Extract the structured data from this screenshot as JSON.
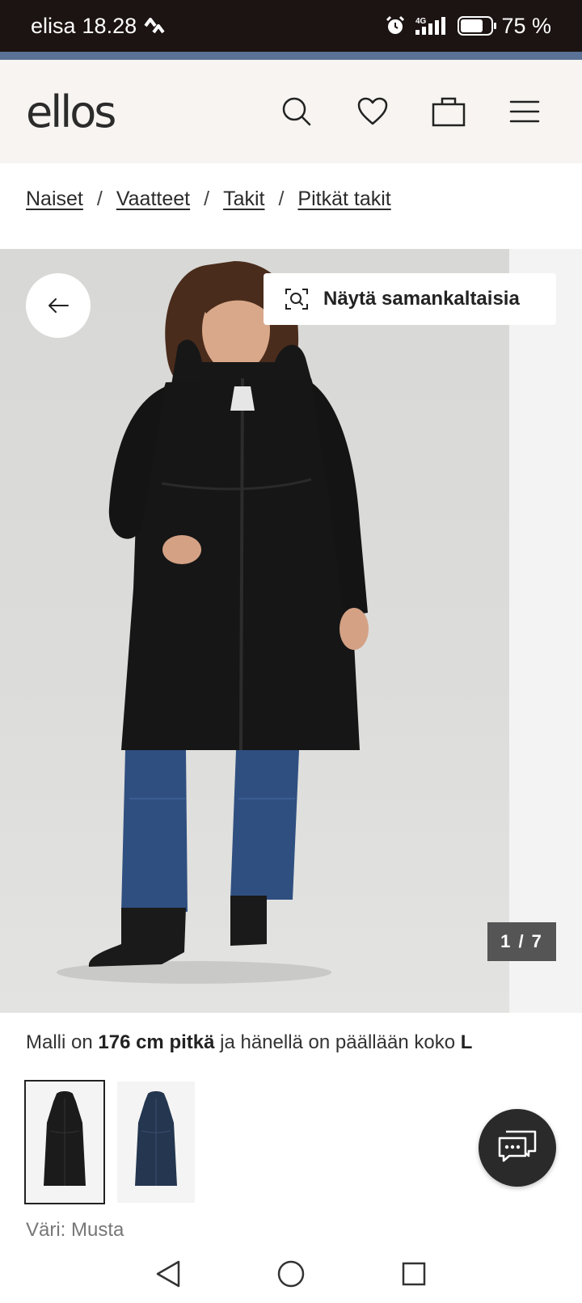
{
  "status_bar": {
    "carrier": "elisa",
    "time": "18.28",
    "network": "4G",
    "battery": "75 %",
    "battery_level": 0.75,
    "icons": [
      "data-saver-icon",
      "alarm-icon",
      "signal-icon",
      "battery-icon"
    ]
  },
  "header": {
    "logo": "ellos",
    "icons": [
      "search-icon",
      "heart-icon",
      "bag-icon",
      "menu-icon"
    ]
  },
  "breadcrumb": {
    "items": [
      "Naiset",
      "Vaatteet",
      "Takit",
      "Pitkät takit"
    ],
    "separator": "/"
  },
  "gallery": {
    "similar_label": "Näytä samankaltaisia",
    "counter": "1 / 7",
    "current": 1,
    "total": 7
  },
  "product": {
    "model_prefix": "Malli on",
    "model_height": "176 cm pitkä",
    "model_middle": "ja hänellä on päällään koko",
    "model_size": "L",
    "color_label": "Väri: Musta",
    "swatches": [
      {
        "name": "Musta",
        "color": "#1b1b1b"
      },
      {
        "name": "Navy",
        "color": "#243650"
      }
    ]
  },
  "colors": {
    "status_bar_bg": "#1c1412",
    "accent_strip": "#5b7297",
    "header_bg": "#f7f4f1",
    "coat": "#151515",
    "jeans": "#2f4f80"
  }
}
